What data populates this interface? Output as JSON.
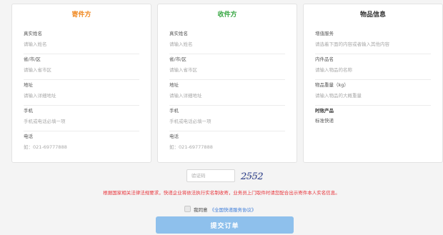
{
  "sender": {
    "title": "寄件方",
    "fields": [
      {
        "label": "真实姓名",
        "placeholder": "请输入姓名"
      },
      {
        "label": "省/市/区",
        "placeholder": "请输入省市区"
      },
      {
        "label": "地址",
        "placeholder": "请输入详细地址"
      },
      {
        "label": "手机",
        "placeholder": "手机或电话必填一项"
      },
      {
        "label": "电话",
        "placeholder": "如：021-69777888"
      }
    ]
  },
  "receiver": {
    "title": "收件方",
    "fields": [
      {
        "label": "真实姓名",
        "placeholder": "请输入姓名"
      },
      {
        "label": "省/市/区",
        "placeholder": "请输入省市区"
      },
      {
        "label": "地址",
        "placeholder": "请输入详细地址"
      },
      {
        "label": "手机",
        "placeholder": "手机或电话必填一项"
      },
      {
        "label": "电话",
        "placeholder": "如：021-69777888"
      }
    ]
  },
  "goods": {
    "title": "物品信息",
    "fields": [
      {
        "label": "增值服务",
        "placeholder": "请选着下面的内容或者输入其他内容"
      },
      {
        "label": "内件品名",
        "placeholder": "请输入物品的名称"
      },
      {
        "label": "物品重量（kg）",
        "placeholder": "请输入物品的大概重量"
      }
    ],
    "product_label": "时效产品",
    "product_value": "标准快递"
  },
  "captcha": {
    "placeholder": "验证码",
    "code": "2552"
  },
  "notice": "根据国家相关法律法规要求，快递企业将依法执行实名制收寄，业务员上门取件时请您配合出示寄件本人实名信息。",
  "agree": {
    "text": "我同意",
    "link": "《全国快递服务协议》"
  },
  "submit_label": "提交订单",
  "colors": {
    "sender_title": "#f08a24",
    "receiver_title": "#3aa845",
    "notice": "#e8343a",
    "link": "#3b7bd8",
    "submit_bg": "#8ec0ec"
  }
}
